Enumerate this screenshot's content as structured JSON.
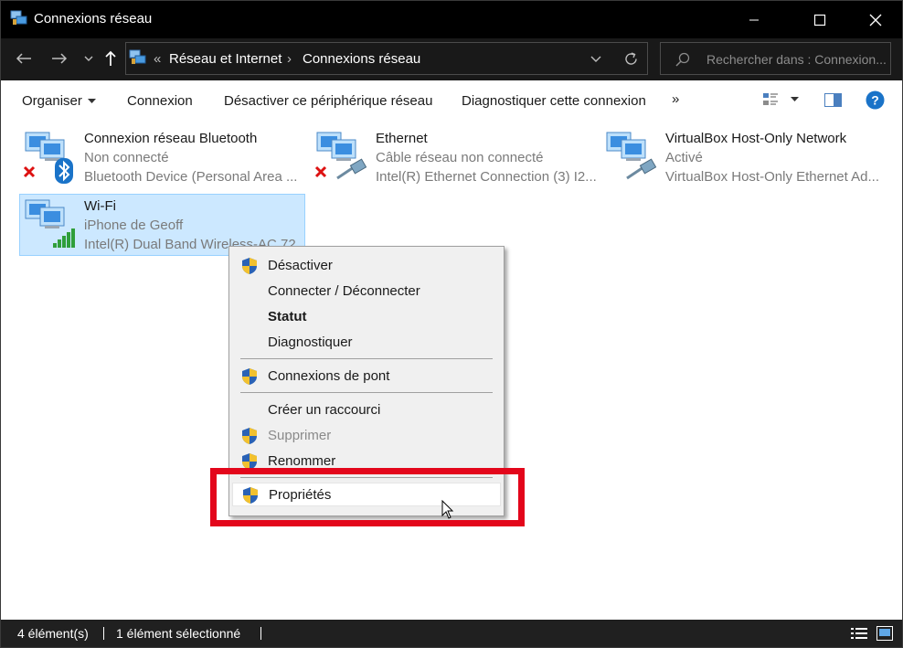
{
  "window": {
    "title": "Connexions réseau"
  },
  "address": {
    "overflow": "«",
    "crumbs": [
      "Réseau et Internet",
      "Connexions réseau"
    ],
    "search_placeholder": "Rechercher dans : Connexion..."
  },
  "toolbar": {
    "organize": "Organiser",
    "connect": "Connexion",
    "disable": "Désactiver ce périphérique réseau",
    "diagnose": "Diagnostiquer cette connexion",
    "more": "»"
  },
  "items": [
    {
      "name": "Connexion réseau Bluetooth",
      "status": "Non connecté",
      "device": "Bluetooth Device (Personal Area ...",
      "icon": "bluetooth-adapter-disconnected-icon"
    },
    {
      "name": "Ethernet",
      "status": "Câble réseau non connecté",
      "device": "Intel(R) Ethernet Connection (3) I2...",
      "icon": "ethernet-adapter-disconnected-icon"
    },
    {
      "name": "VirtualBox Host-Only Network",
      "status": "Activé",
      "device": "VirtualBox Host-Only Ethernet Ad...",
      "icon": "ethernet-adapter-icon"
    },
    {
      "name": "Wi-Fi",
      "status": "iPhone de Geoff",
      "device": "Intel(R) Dual Band Wireless-AC 72...",
      "icon": "wifi-adapter-icon",
      "selected": true
    }
  ],
  "context_menu": {
    "items": [
      {
        "label": "Désactiver",
        "shield": true
      },
      {
        "label": "Connecter / Déconnecter"
      },
      {
        "label": "Statut",
        "bold": true
      },
      {
        "label": "Diagnostiquer"
      },
      {
        "label": "Connexions de pont",
        "shield": true
      },
      {
        "label": "Créer un raccourci"
      },
      {
        "label": "Supprimer",
        "shield": true,
        "disabled": true
      },
      {
        "label": "Renommer",
        "shield": true
      },
      {
        "label": "Propriétés",
        "shield": true,
        "hover": true
      }
    ]
  },
  "statusbar": {
    "count": "4 élément(s)",
    "selected": "1 élément sélectionné"
  },
  "colors": {
    "highlight": "#e3061b",
    "selection": "#cce8ff",
    "accent": "#0078d7"
  }
}
